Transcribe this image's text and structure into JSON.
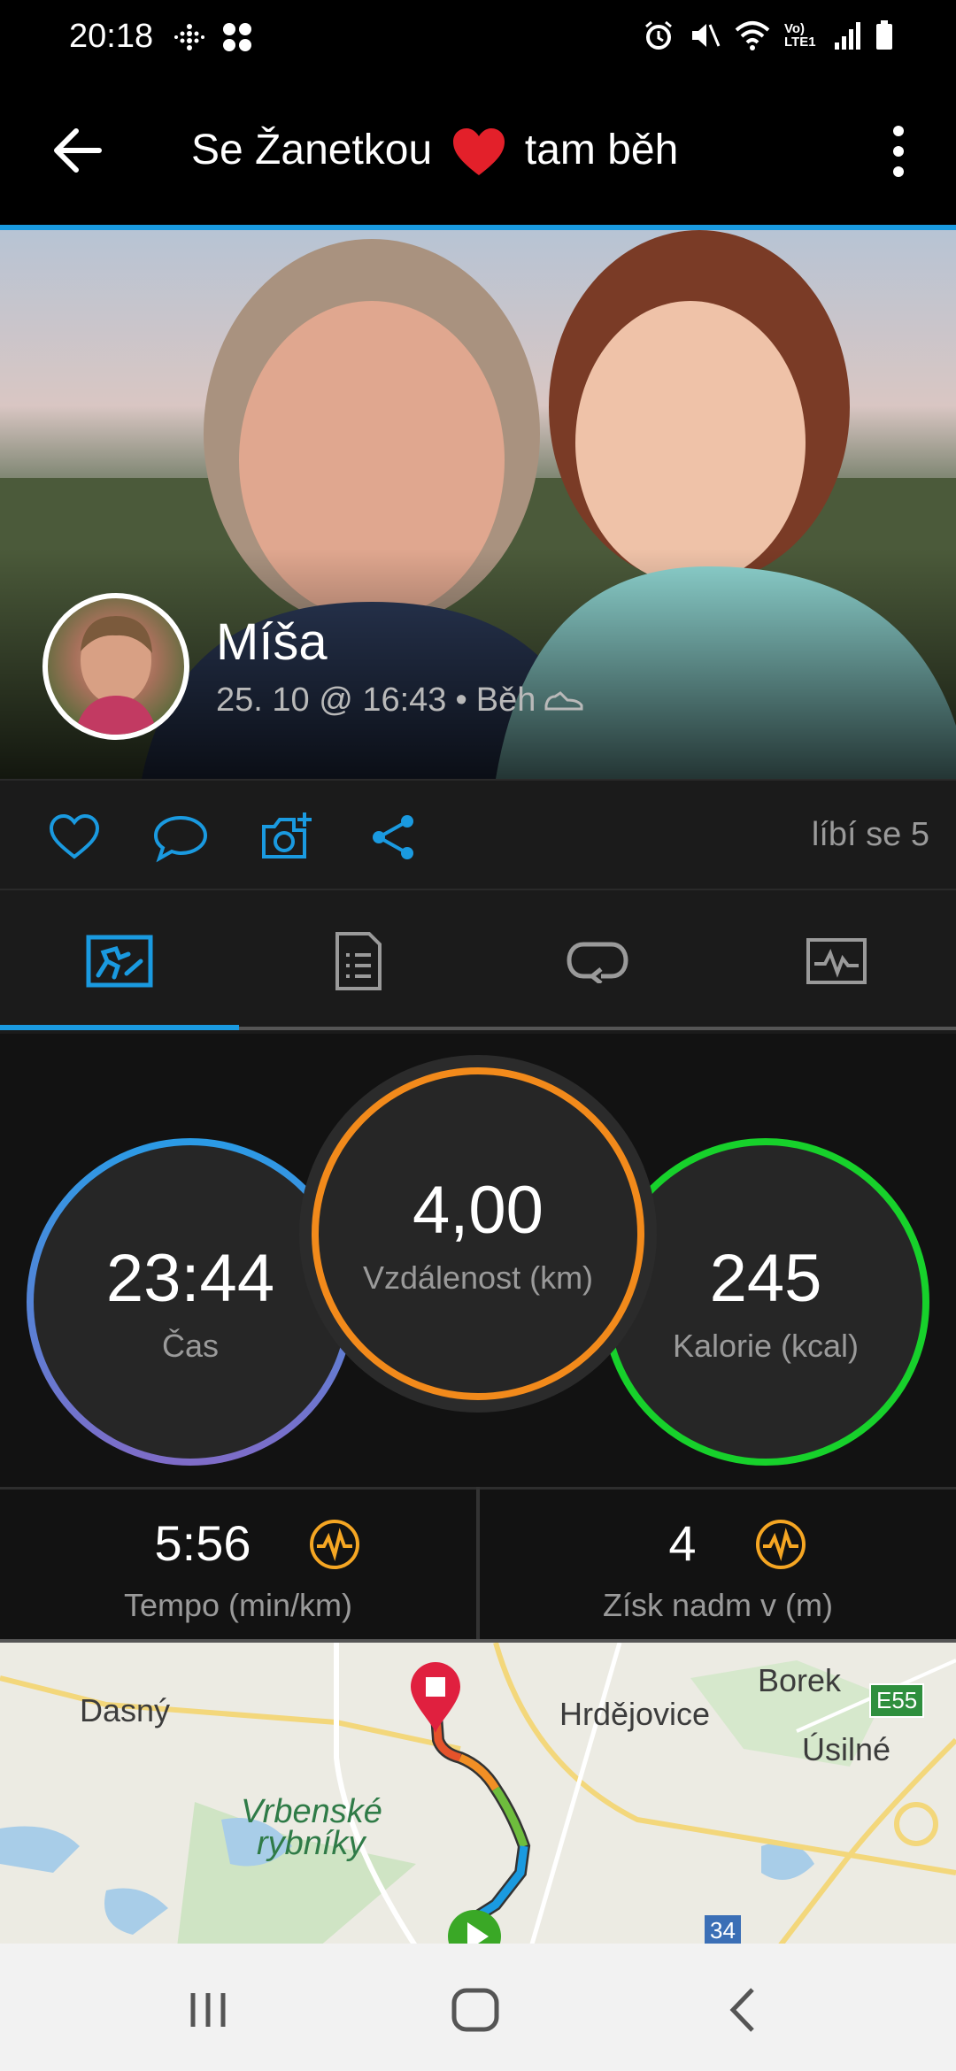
{
  "status_bar": {
    "time": "20:18",
    "left_icons": [
      "fitbit-icon",
      "apps-icon"
    ],
    "right_icons": [
      "alarm-icon",
      "mute-icon",
      "wifi-icon",
      "volte-lte-icon",
      "signal-icon",
      "battery-icon"
    ],
    "volte_label": "Vo) LTE1"
  },
  "appbar": {
    "title_part1": "Se Žanetkou",
    "title_part2": "tam běh",
    "heart_color": "#e3202a"
  },
  "activity": {
    "user_name": "Míša",
    "date_time": "25. 10 @ 16:43",
    "separator": "•",
    "activity_type": "Běh"
  },
  "social": {
    "likes_text": "líbí se 5",
    "accent": "#1a9ae0"
  },
  "tabs": [
    {
      "name": "overview",
      "icon": "runner-overview-icon",
      "active": true
    },
    {
      "name": "details",
      "icon": "document-list-icon",
      "active": false
    },
    {
      "name": "laps",
      "icon": "loop-icon",
      "active": false
    },
    {
      "name": "charts",
      "icon": "chart-icon",
      "active": false
    }
  ],
  "stats": {
    "time_value": "23:44",
    "time_label": "Čas",
    "distance_value": "4,00",
    "distance_label": "Vzdálenost (km)",
    "calories_value": "245",
    "calories_label": "Kalorie (kcal)",
    "pace_value": "5:56",
    "pace_label": "Tempo (min/km)",
    "elevation_value": "4",
    "elevation_label": "Získ nadm v (m)",
    "colors": {
      "time": "#2a9be6",
      "distance": "#f28a1b",
      "calories": "#17d12b",
      "badge": "#f5a623"
    }
  },
  "map": {
    "places": {
      "dasny": "Dasný",
      "hrdejovice": "Hrdějovice",
      "borek": "Borek",
      "usilne": "Úsilné",
      "vrbenske1": "Vrbenské",
      "vrbenske2": "rybníky"
    },
    "road_badge_e55": "E55",
    "road_badge_34": "34"
  },
  "navbar": {
    "buttons": [
      "recents-icon",
      "home-icon",
      "back-icon"
    ]
  }
}
